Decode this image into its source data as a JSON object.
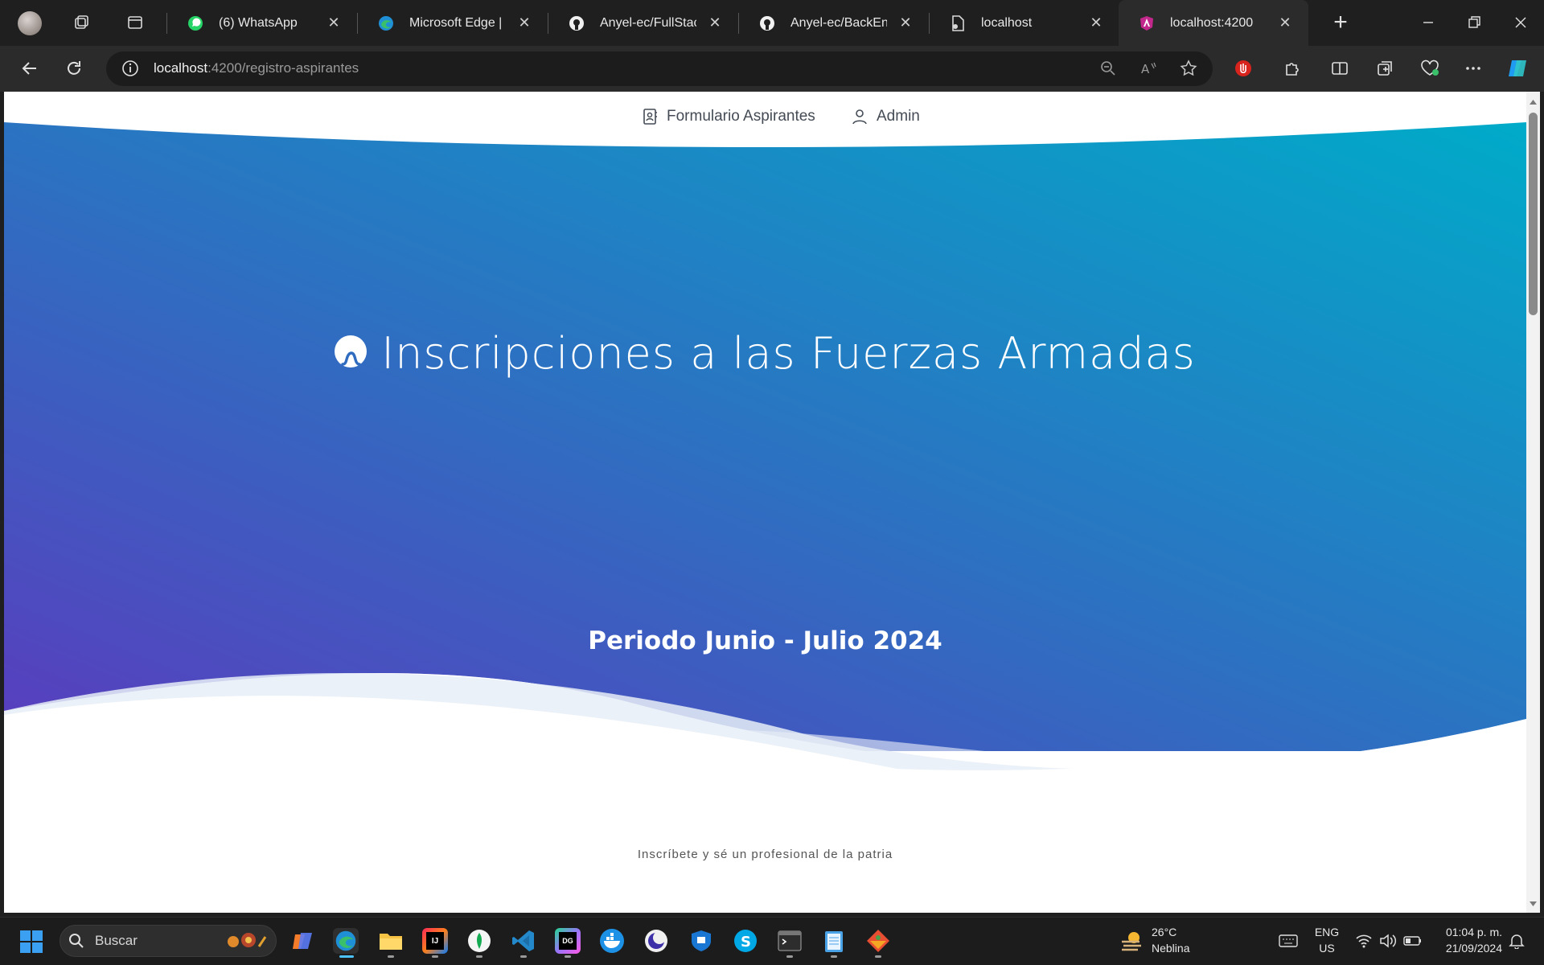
{
  "browser": {
    "tabs": [
      {
        "title": "(6) WhatsApp",
        "icon": "whatsapp-icon"
      },
      {
        "title": "Microsoft Edge | N",
        "icon": "edge-icon"
      },
      {
        "title": "Anyel-ec/FullStack",
        "icon": "github-icon"
      },
      {
        "title": "Anyel-ec/BackEnd",
        "icon": "github-icon"
      },
      {
        "title": "localhost",
        "icon": "page-icon"
      },
      {
        "title": "localhost:4200",
        "icon": "angular-icon"
      }
    ],
    "new_tab": "+",
    "close_glyph": "✕",
    "address": {
      "host": "localhost",
      "path": ":4200/registro-aspirantes"
    }
  },
  "page": {
    "nav": [
      {
        "label": "Formulario Aspirantes",
        "icon": "contact-book-icon"
      },
      {
        "label": "Admin",
        "icon": "user-icon"
      }
    ],
    "hero_title": "Inscripciones a las Fuerzas Armadas",
    "period": "Periodo Junio - Julio 2024",
    "tagline": "Inscríbete y sé un profesional de la patria",
    "colors": {
      "gradient_start": "#5a3fbf",
      "gradient_mid": "#2f6cc0",
      "gradient_end": "#00a8c9"
    }
  },
  "taskbar": {
    "search_placeholder": "Buscar",
    "weather": {
      "temp": "26°C",
      "condition": "Neblina"
    },
    "lang": {
      "line1": "ENG",
      "line2": "US"
    },
    "time": "01:04 p. m.",
    "date": "21/09/2024"
  }
}
